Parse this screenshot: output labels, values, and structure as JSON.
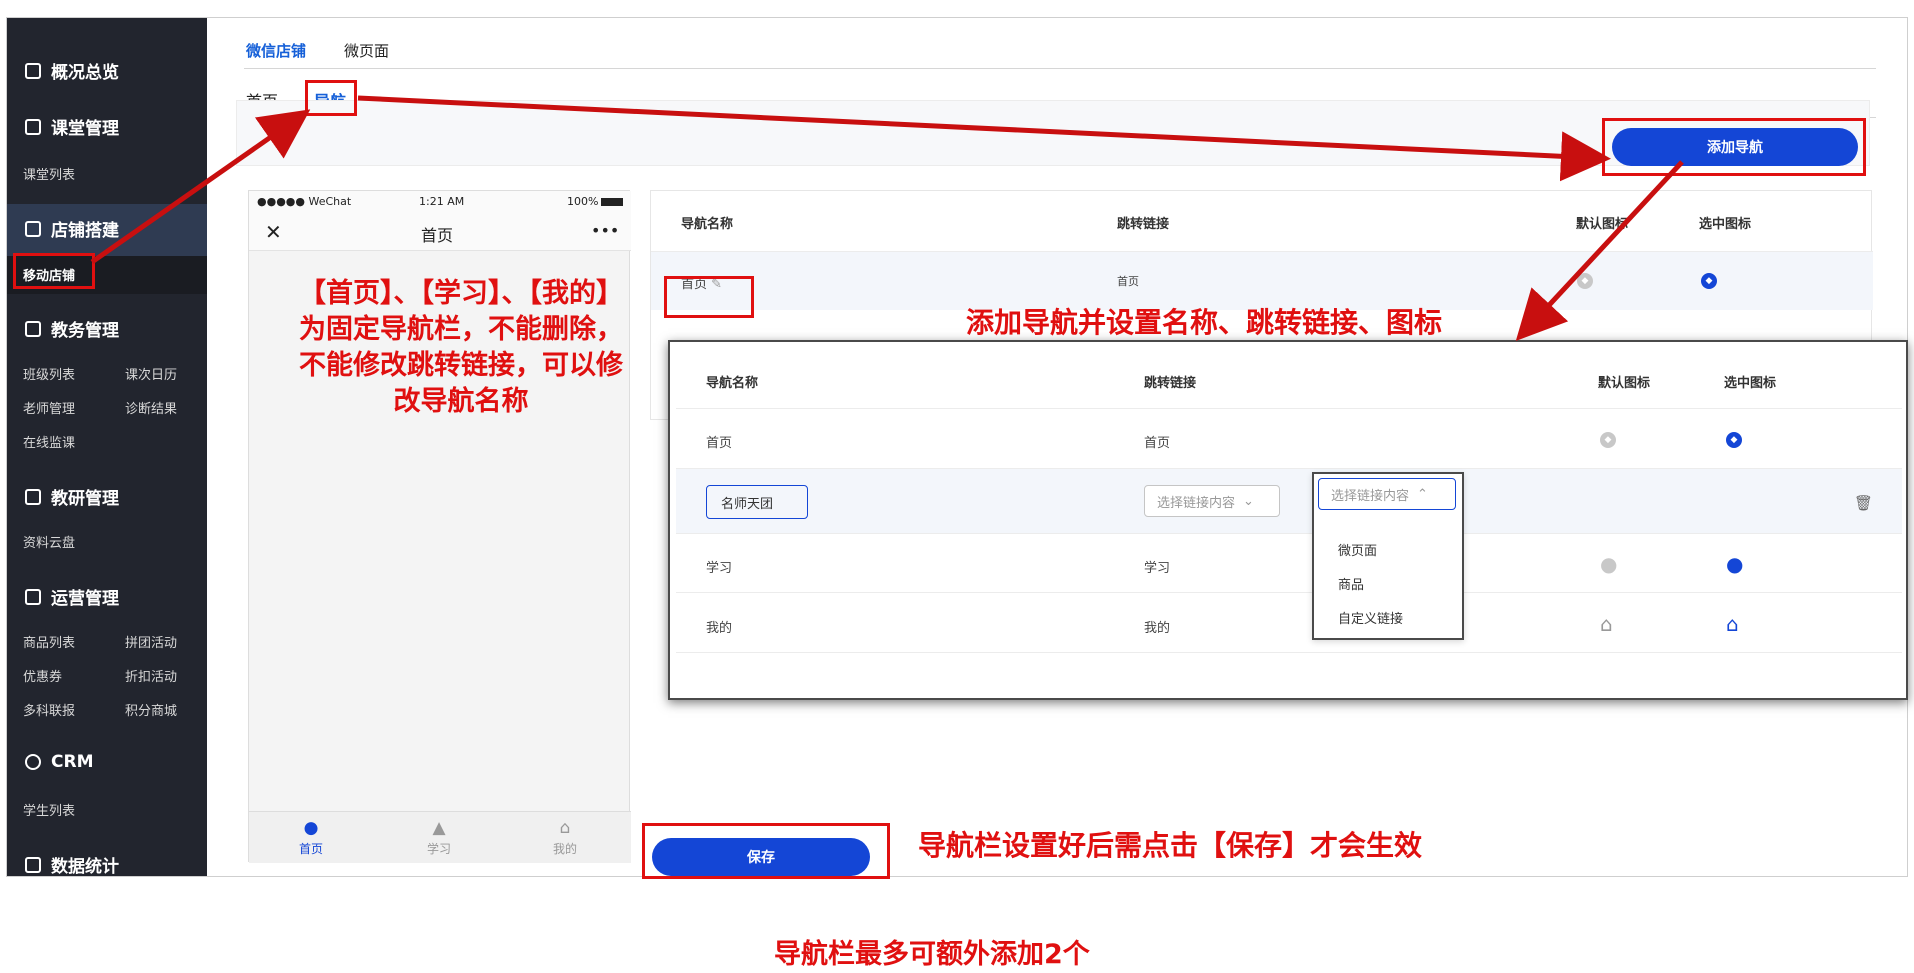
{
  "sidebar": {
    "overview": "概况总览",
    "classroom": "课堂管理",
    "classroom_list": "课堂列表",
    "store": "店铺搭建",
    "mobile_store": "移动店铺",
    "academic": "教务管理",
    "academic_items": [
      "班级列表",
      "课次日历",
      "老师管理",
      "诊断结果",
      "在线监课"
    ],
    "research": "教研管理",
    "research_items": [
      "资料云盘"
    ],
    "operations": "运营管理",
    "operations_items": [
      "商品列表",
      "拼团活动",
      "优惠券",
      "折扣活动",
      "多科联报",
      "积分商城"
    ],
    "crm": "CRM",
    "crm_items": [
      "学生列表"
    ],
    "stats": "数据统计"
  },
  "top_tabs": [
    "微信店铺",
    "微页面"
  ],
  "sub_tabs": [
    "首页",
    "导航"
  ],
  "add_nav_button": "添加导航",
  "save_button": "保存",
  "phone": {
    "carrier": "●●●●● WeChat",
    "time": "1:21 AM",
    "battery": "100%",
    "title": "首页",
    "close": "✕",
    "more": "•••",
    "tabs": [
      "首页",
      "学习",
      "我的"
    ]
  },
  "table": {
    "headers": [
      "导航名称",
      "跳转链接",
      "默认图标",
      "选中图标"
    ],
    "first_row": {
      "name": "首页",
      "link": "首页"
    }
  },
  "overlay": {
    "headers": [
      "导航名称",
      "跳转链接",
      "默认图标",
      "选中图标"
    ],
    "rows": [
      {
        "name": "首页",
        "link": "首页"
      },
      {
        "name": "学习",
        "link": "学习"
      },
      {
        "name": "我的",
        "link": "我的"
      }
    ],
    "new_row_name": "名师天团",
    "select_placeholder": "选择链接内容",
    "dropdown_placeholder": "选择链接内容",
    "dropdown_options": [
      "微页面",
      "商品",
      "自定义链接"
    ]
  },
  "annotations": {
    "fixed_nav": "【首页】、【学习】、【我的】为固定导航栏，不能删除，不能修改跳转链接，可以修改导航名称",
    "add_nav": "添加导航并设置名称、跳转链接、图标",
    "save_note": "导航栏设置好后需点击【保存】才会生效",
    "max_note": "导航栏最多可额外添加2个"
  },
  "colors": {
    "accent": "#1446d6",
    "annotation": "#e01010",
    "sidebar": "#22252e"
  }
}
